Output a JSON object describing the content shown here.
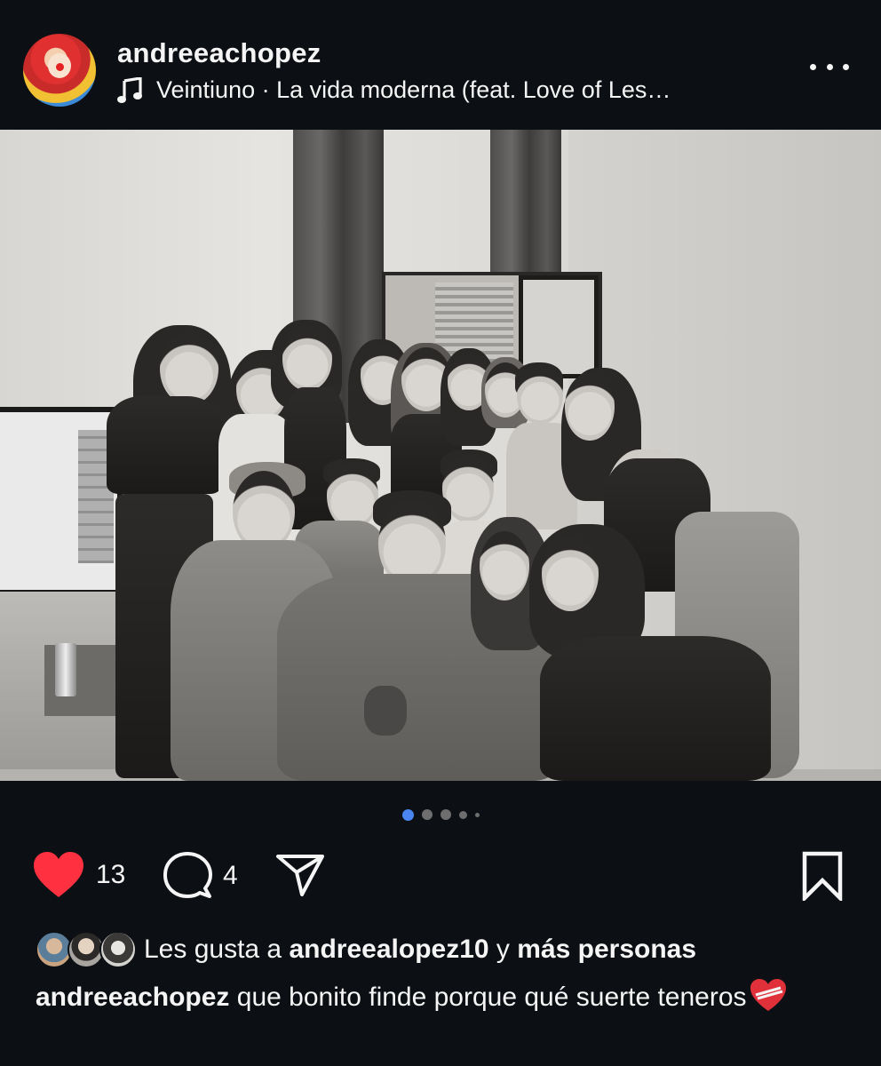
{
  "post": {
    "username": "andreeachopez",
    "music": "Veintiuno · La vida moderna (feat. Love of Les…",
    "avatar_icon": "clown-avatar",
    "carousel": {
      "total_dots": 5,
      "active_index": 0
    }
  },
  "actions": {
    "likes_count": "13",
    "comments_count": "4",
    "like_color": "#ff3040"
  },
  "likes": {
    "prefix": "Les gusta a",
    "user": "andreealopez10",
    "connector": "y",
    "others": "más personas"
  },
  "caption": {
    "username": "andreeachopez",
    "text": "que bonito finde porque qué suerte teneros"
  },
  "colors": {
    "background": "#0c1014",
    "text": "#f5f5f5",
    "accent_dot": "#4a86f0"
  }
}
